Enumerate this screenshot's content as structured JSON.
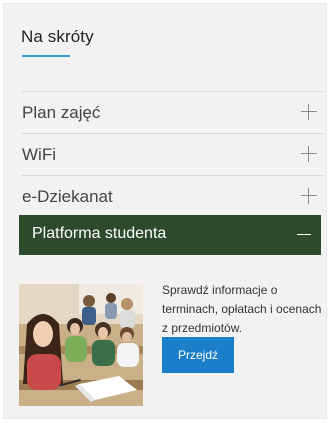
{
  "widget": {
    "title": "Na skróty",
    "accent_color": "#3a9bd8"
  },
  "accordion": {
    "items": [
      {
        "label": "Plan zajęć",
        "expanded": false,
        "icon": "plus-icon"
      },
      {
        "label": "WiFi",
        "expanded": false,
        "icon": "plus-icon"
      },
      {
        "label": "e-Dziekanat",
        "expanded": false,
        "icon": "plus-icon"
      },
      {
        "label": "Platforma studenta",
        "expanded": true,
        "icon": "minus-icon"
      }
    ],
    "active_color": "#2d4a2d"
  },
  "panel": {
    "description": "Sprawdź informacje o terminach, opłatach i ocenach z przedmiotów.",
    "button_label": "Przejdź",
    "button_color": "#1a7ec8",
    "image": "students-in-lecture-hall-photo"
  }
}
